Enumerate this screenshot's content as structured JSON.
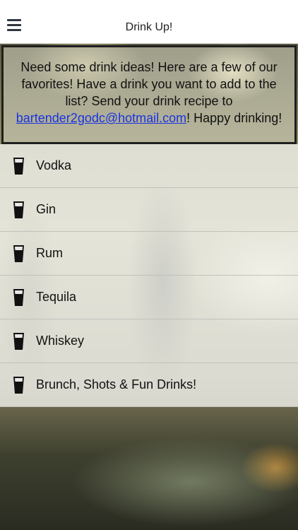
{
  "header": {
    "title": "Drink Up!",
    "menu_icon": "hamburger-menu-icon"
  },
  "intro": {
    "text_before": "Need some drink ideas! Here are a few of our favorites! Have a drink you want to add to the list? Send your drink recipe to ",
    "email": "bartender2godc@hotmail.com",
    "text_after": "! Happy drinking!",
    "link_color": "#1a33e0"
  },
  "list": {
    "icon": "shot-glass-icon",
    "items": [
      {
        "label": "Vodka"
      },
      {
        "label": "Gin"
      },
      {
        "label": "Rum"
      },
      {
        "label": "Tequila"
      },
      {
        "label": "Whiskey"
      },
      {
        "label": "Brunch, Shots & Fun Drinks!"
      }
    ]
  }
}
